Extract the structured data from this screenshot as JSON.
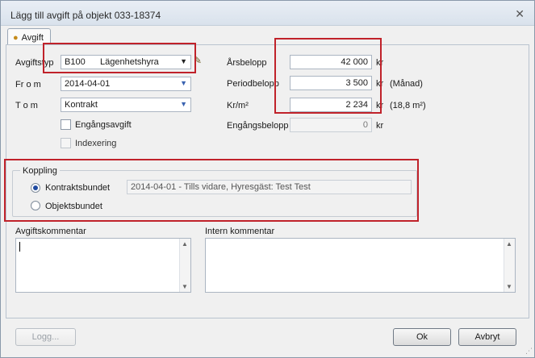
{
  "window": {
    "title": "Lägg till avgift på objekt 033-18374",
    "close_symbol": "✕"
  },
  "tab": {
    "label": "Avgift"
  },
  "form": {
    "avgiftstyp_label": "Avgiftstyp",
    "avgiftstyp_code": "B100",
    "avgiftstyp_name": "Lägenhetshyra",
    "from_label": "Fr o m",
    "from_value": "2014-04-01",
    "tom_label": "T o m",
    "tom_value": "Kontrakt",
    "engangsavgift_label": "Engångsavgift",
    "indexering_label": "Indexering",
    "arsbelopp_label": "Årsbelopp",
    "arsbelopp_value": "42 000",
    "periodbelopp_label": "Periodbelopp",
    "periodbelopp_value": "3 500",
    "periodbelopp_note": "(Månad)",
    "krm2_label": "Kr/m²",
    "krm2_value": "2 234",
    "krm2_note": "(18,8 m²)",
    "engangsbelopp_label": "Engångsbelopp",
    "engangsbelopp_value": "0",
    "unit": "kr"
  },
  "koppling": {
    "title": "Koppling",
    "kontraktsbundet_label": "Kontraktsbundet",
    "kontrakt_value": "2014-04-01 - Tills vidare, Hyresgäst: Test Test",
    "objektsbundet_label": "Objektsbundet",
    "selected": "Kontraktsbundet"
  },
  "comments": {
    "avgift_label": "Avgiftskommentar",
    "intern_label": "Intern kommentar"
  },
  "buttons": {
    "logg": "Logg...",
    "ok": "Ok",
    "avbryt": "Avbryt"
  },
  "colors": {
    "highlight_red": "#c0222a",
    "radio_selected": "#1f4aa0"
  }
}
